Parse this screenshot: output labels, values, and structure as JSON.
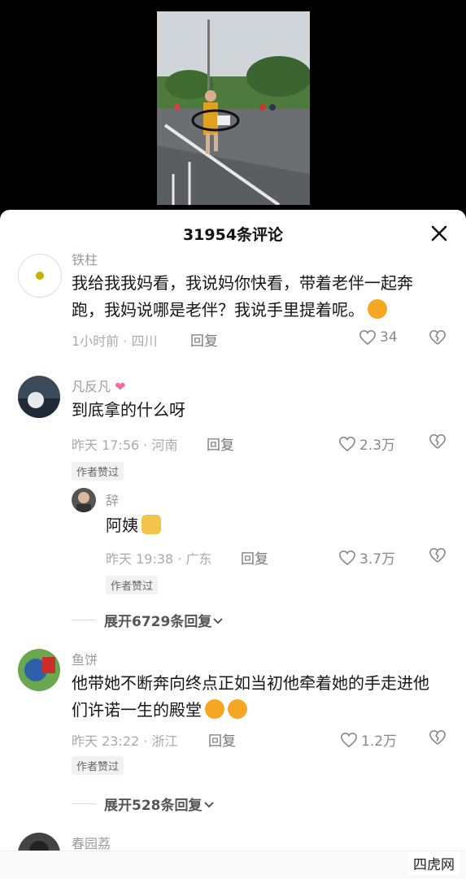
{
  "header": {
    "title": "31954条评论"
  },
  "comments": [
    {
      "user": "铁柱",
      "text": "我给我我妈看，我说妈你快看，带着老伴一起奔跑，我妈说哪是老伴？我说手里提着呢。",
      "meta": "1小时前 · 四川",
      "reply": "回复",
      "likes": "34"
    },
    {
      "user": "凡反凡",
      "text": "到底拿的什么呀",
      "meta": "昨天 17:56 · 河南",
      "reply": "回复",
      "likes": "2.3万",
      "badge": "作者赞过"
    },
    {
      "user": "辞",
      "text": "阿姨",
      "meta": "昨天 19:38 · 广东",
      "reply": "回复",
      "likes": "3.7万",
      "badge": "作者赞过",
      "expand": "展开6729条回复"
    },
    {
      "user": "鱼饼",
      "text": "他带她不断奔向终点正如当初他牵着她的手走进他们许诺一生的殿堂",
      "meta": "昨天 23:22 · 浙江",
      "reply": "回复",
      "likes": "1.2万",
      "badge": "作者赞过",
      "expand": "展开528条回复"
    },
    {
      "user": "春园荔"
    }
  ],
  "watermark": "四虎网",
  "icons": [
    "close-icon",
    "heart-icon",
    "broken-heart-icon",
    "chevron-down-icon"
  ]
}
